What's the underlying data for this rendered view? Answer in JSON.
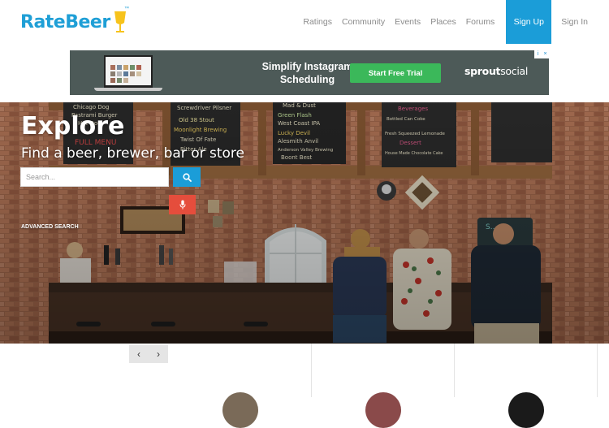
{
  "header": {
    "logo_text": "RateBeer",
    "logo_tm": "™",
    "nav": [
      {
        "label": "Ratings"
      },
      {
        "label": "Community"
      },
      {
        "label": "Events"
      },
      {
        "label": "Places"
      },
      {
        "label": "Forums"
      }
    ],
    "signup_label": "Sign Up",
    "signin_label": "Sign In"
  },
  "ad": {
    "headline": "Simplify Instagram Scheduling",
    "cta": "Start Free Trial",
    "brand_bold": "sprout",
    "brand_rest": "social",
    "choices_i": "i",
    "choices_x": "×"
  },
  "hero": {
    "title": "Explore",
    "subtitle": "Find a beer, brewer, bar or store",
    "search_placeholder": "Search...",
    "advanced_search": "ADVANCED SEARCH",
    "chalkboards": {
      "left": [
        "Chicago Dog",
        "Pastrami Burger",
        "Hot Dog",
        "FULL MENU"
      ],
      "center_left": [
        "Screwdriver Pilsner",
        "Old 38 Stout",
        "Moonlight Brewing",
        "Twist Of Fate",
        "Bitter Ale"
      ],
      "center": [
        "Mad & Dust",
        "Green Flash",
        "West Coast IPA",
        "Lucky Devil",
        "Alesmith Anvil",
        "Anderson Valley Brewing",
        "Boont Best"
      ],
      "right": [
        "Beverages",
        "Bottled Can Coke",
        "Fresh Squeezed Lemonade",
        "Dessert",
        "House Made Chocolate Cake"
      ]
    }
  },
  "pager": {
    "prev": "‹",
    "next": "›"
  },
  "colors": {
    "brand_blue": "#1b9dd8",
    "mic_red": "#e54d3c",
    "ad_green": "#3bb85a",
    "ad_bg": "#4d5a58"
  }
}
